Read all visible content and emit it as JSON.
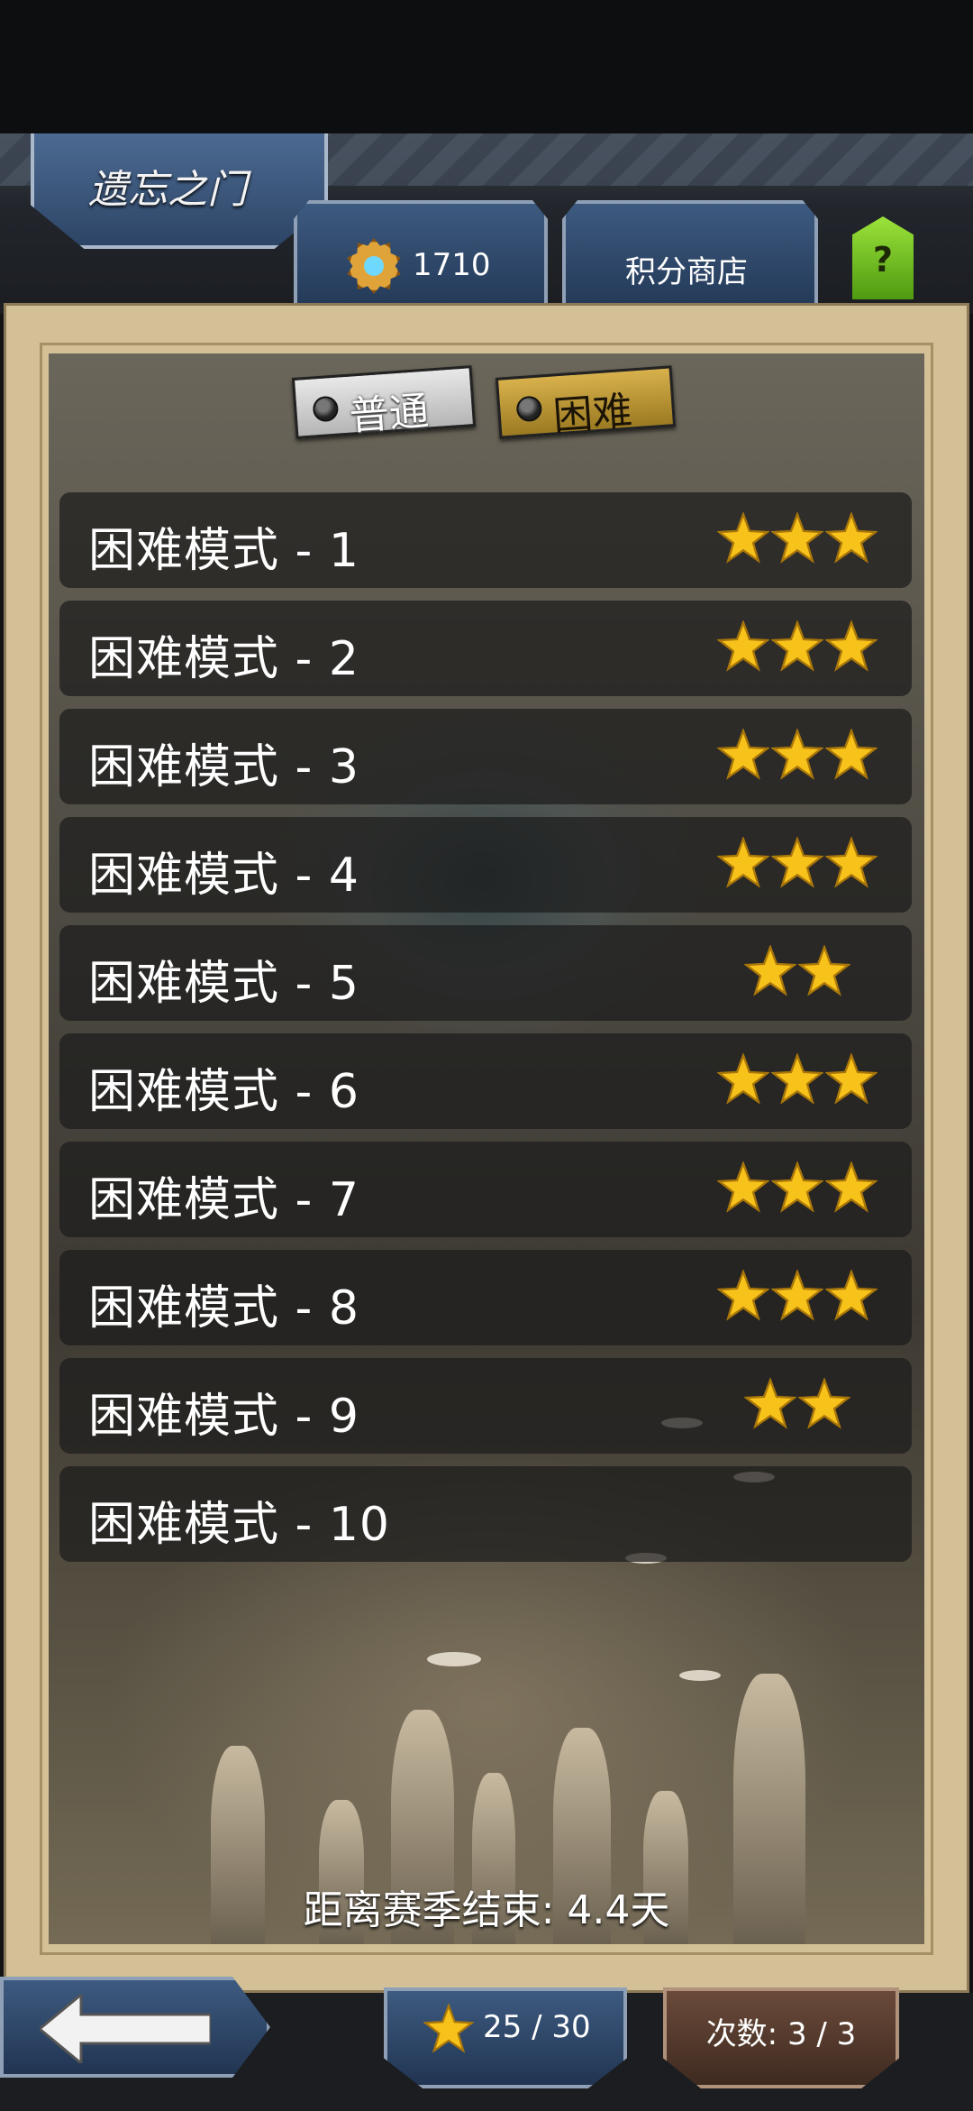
{
  "header": {
    "title": "遗忘之门",
    "coins": "1710",
    "shop_label": "积分商店",
    "help_label": "?"
  },
  "mode_toggle": {
    "normal_label": "普通",
    "hard_label": "困难",
    "selected": "困难"
  },
  "levels": [
    {
      "name": "困难模式 - 1",
      "stars": 3
    },
    {
      "name": "困难模式 - 2",
      "stars": 3
    },
    {
      "name": "困难模式 - 3",
      "stars": 3
    },
    {
      "name": "困难模式 - 4",
      "stars": 3
    },
    {
      "name": "困难模式 - 5",
      "stars": 2
    },
    {
      "name": "困难模式 - 6",
      "stars": 3
    },
    {
      "name": "困难模式 - 7",
      "stars": 3
    },
    {
      "name": "困难模式 - 8",
      "stars": 3
    },
    {
      "name": "困难模式 - 9",
      "stars": 2
    },
    {
      "name": "困难模式 - 10",
      "stars": 0
    }
  ],
  "season": "距离赛季结束: 4.4天",
  "footer": {
    "stars_total": "25 / 30",
    "attempts": "次数: 3 / 3"
  },
  "colors": {
    "star": "#f7c21a",
    "hard_tab": "#c9a23c",
    "panel_frame": "#d3c097",
    "header_plate": "#3d5a80"
  }
}
